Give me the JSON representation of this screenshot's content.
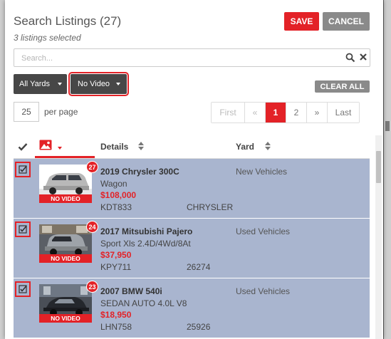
{
  "header": {
    "title": "Search Listings (27)",
    "subtitle": "3 listings selected",
    "save_label": "SAVE",
    "cancel_label": "CANCEL"
  },
  "search": {
    "placeholder": "Search..."
  },
  "filters": {
    "yards_label": "All Yards",
    "video_label": "No Video",
    "clear_all_label": "CLEAR ALL"
  },
  "per_page": {
    "value": "25",
    "label": "per page"
  },
  "pagination": {
    "first": "First",
    "prev": "«",
    "pages": [
      "1",
      "2"
    ],
    "next": "»",
    "last": "Last",
    "current": "1"
  },
  "table": {
    "col_details": "Details",
    "col_yard": "Yard",
    "rows": [
      {
        "title": "2019 Chrysler 300C",
        "subtitle": "Wagon",
        "price": "$108,000",
        "stock": "KDT833",
        "extra": "CHRYSLER",
        "yard": "New Vehicles",
        "badge": "27",
        "no_video": "NO VIDEO",
        "checked": true
      },
      {
        "title": "2017 Mitsubishi Pajero",
        "subtitle": "Sport Xls 2.4D/4Wd/8At",
        "price": "$37,950",
        "stock": "KPY711",
        "extra": "26274",
        "yard": "Used Vehicles",
        "badge": "24",
        "no_video": "NO VIDEO",
        "checked": true
      },
      {
        "title": "2007 BMW 540i",
        "subtitle": "SEDAN AUTO 4.0L V8",
        "price": "$18,950",
        "stock": "LHN758",
        "extra": "25926",
        "yard": "Used Vehicles",
        "badge": "23",
        "no_video": "NO VIDEO",
        "checked": true
      }
    ]
  },
  "colors": {
    "accent": "#e32227",
    "row_selected": "#a9b5cf",
    "dark_button": "#474747",
    "grey_button": "#8a8a8a"
  }
}
